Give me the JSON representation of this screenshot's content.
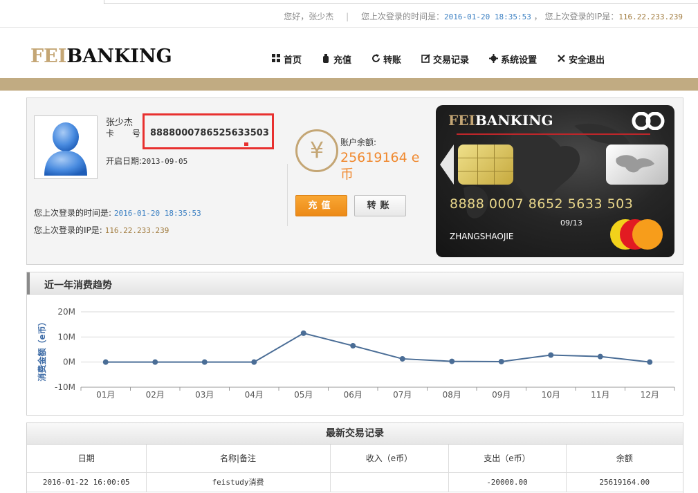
{
  "top_bar": {
    "greeting": "您好，张少杰",
    "separator": "|",
    "last_login_time_label": "您上次登录的时间是：",
    "last_login_time": "2016-01-20 18:35:53",
    "comma": "，",
    "last_login_ip_label": "您上次登录的IP是：",
    "last_login_ip": "116.22.233.239"
  },
  "header": {
    "logo_fei": "FEI",
    "logo_banking": "BANKING",
    "nav": [
      {
        "label": "首页",
        "icon": "grid-icon"
      },
      {
        "label": "充值",
        "icon": "wallet-icon"
      },
      {
        "label": "转账",
        "icon": "refresh-icon"
      },
      {
        "label": "交易记录",
        "icon": "edit-icon"
      },
      {
        "label": "系统设置",
        "icon": "gear-icon"
      },
      {
        "label": "安全退出",
        "icon": "close-icon"
      }
    ]
  },
  "account": {
    "name": "张少杰",
    "card_label": "卡号",
    "card_number": "8888000786525633503",
    "open_date_label": "开启日期:",
    "open_date": "2013-09-05",
    "last_time_label": "您上次登录的时间是:",
    "last_time": "2016-01-20 18:35:53",
    "last_ip_label": "您上次登录的IP是:",
    "last_ip": "116.22.233.239",
    "currency_symbol": "¥",
    "balance_label": "账户余额:",
    "balance": "25619164 e 币",
    "charge_button": "充值",
    "transfer_button": "转账"
  },
  "bank_card": {
    "logo_fei": "FEI",
    "logo_banking": "BANKING",
    "number": "8888 0007 8652 5633 503",
    "expiry": "09/13",
    "holder": "ZHANGSHAOJIE"
  },
  "chart_section": {
    "title": "近一年消费趋势"
  },
  "chart_data": {
    "type": "line",
    "title": "近一年消费趋势",
    "xlabel": "",
    "ylabel": "消费金额（e币）",
    "categories": [
      "01月",
      "02月",
      "03月",
      "04月",
      "05月",
      "06月",
      "07月",
      "08月",
      "09月",
      "10月",
      "11月",
      "12月"
    ],
    "values": [
      0,
      0,
      0,
      0,
      11500000,
      6500000,
      1300000,
      300000,
      200000,
      2800000,
      2200000,
      0
    ],
    "ylim": [
      -10000000,
      20000000
    ],
    "yticks": [
      {
        "value": 20000000,
        "label": "20M"
      },
      {
        "value": 10000000,
        "label": "10M"
      },
      {
        "value": 0,
        "label": "0M"
      },
      {
        "value": -10000000,
        "label": "-10M"
      }
    ],
    "grid": true,
    "line_color": "#4a6d96"
  },
  "transactions": {
    "title": "最新交易记录",
    "columns": [
      "日期",
      "名称|备注",
      "收入（e币）",
      "支出（e币）",
      "余额"
    ],
    "rows": [
      [
        "2016-01-22 16:00:05",
        "feistudy消费",
        "",
        "-20000.00",
        "25619164.00"
      ]
    ]
  }
}
